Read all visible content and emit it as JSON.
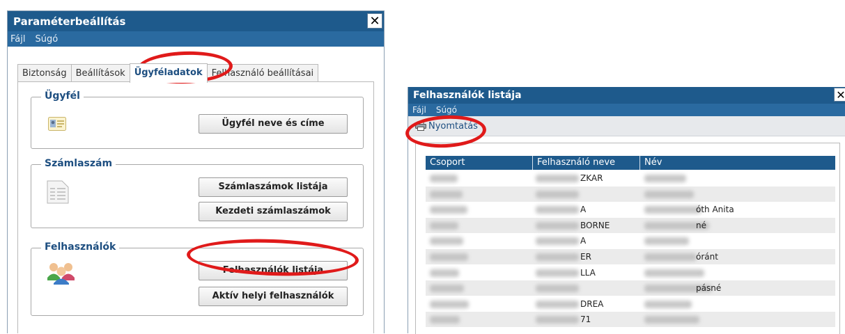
{
  "param_window": {
    "title": "Paraméterbeállítás",
    "close": "✕",
    "menu": [
      "Fájl",
      "Súgó"
    ],
    "tabs": [
      "Biztonság",
      "Beállítások",
      "Ügyféladatok",
      "Felhasználó beállításai"
    ],
    "groups": {
      "ugyfel": {
        "legend": "Ügyfél",
        "button": "Ügyfél neve és címe"
      },
      "szamlaszam": {
        "legend": "Számlaszám",
        "buttons": [
          "Számlaszámok listája",
          "Kezdeti számlaszámok"
        ]
      },
      "felhasznalok": {
        "legend": "Felhasználók",
        "buttons": [
          "Felhasználók listája",
          "Aktív helyi felhasználók"
        ]
      }
    }
  },
  "users_window": {
    "title": "Felhasználók listája",
    "close": "✕",
    "menu": [
      "Fájl",
      "Súgó"
    ],
    "print": "Nyomtatás",
    "columns": [
      "Csoport",
      "Felhasználó neve",
      "Név"
    ],
    "rows": [
      {
        "user_tail": "ZKAR",
        "name_tail": ""
      },
      {
        "user_tail": "",
        "name_tail": ""
      },
      {
        "user_tail": "A",
        "name_tail": "óth Anita"
      },
      {
        "user_tail": "BORNE",
        "name_tail": "né"
      },
      {
        "user_tail": "A",
        "name_tail": ""
      },
      {
        "user_tail": "ER",
        "name_tail": "óránt"
      },
      {
        "user_tail": "LLA",
        "name_tail": ""
      },
      {
        "user_tail": "",
        "name_tail": "pásné"
      },
      {
        "user_tail": "DREA",
        "name_tail": ""
      },
      {
        "user_tail": "71",
        "name_tail": ""
      }
    ]
  },
  "colors": {
    "title_blue": "#1e5a8c",
    "annotation_red": "#e01a1a"
  }
}
